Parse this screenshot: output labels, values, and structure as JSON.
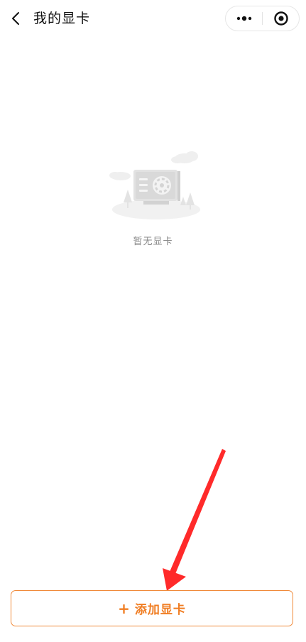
{
  "header": {
    "title": "我的显卡",
    "back_icon": "chevron-left-icon",
    "capsule": {
      "more_icon": "more-dots-icon",
      "close_icon": "target-circle-icon"
    }
  },
  "empty_state": {
    "illustration": "empty-graphics-card-illustration",
    "message": "暂无显卡"
  },
  "footer": {
    "add_button_icon": "+",
    "add_button_label": "添加显卡"
  },
  "colors": {
    "accent": "#f07d22",
    "annotation_arrow": "#ff2a2a"
  }
}
